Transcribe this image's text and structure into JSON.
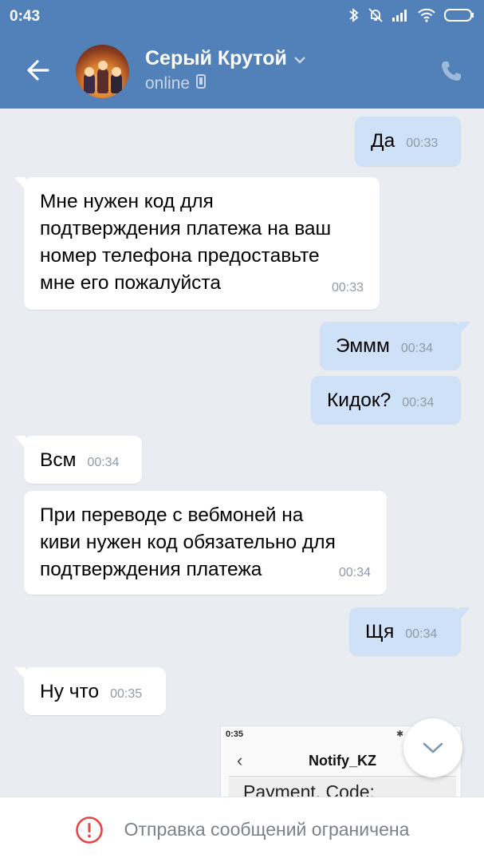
{
  "status_bar": {
    "time": "0:43",
    "icons": [
      "bluetooth-icon",
      "mute-bell-icon",
      "signal-icon",
      "wifi-icon",
      "battery-icon"
    ]
  },
  "header": {
    "contact_name": "Серый Крутой",
    "contact_status": "online",
    "icons": [
      "back-arrow-icon",
      "chevron-down-icon",
      "mobile-icon",
      "phone-icon"
    ]
  },
  "messages": [
    {
      "direction": "out",
      "text": "Да",
      "time": "00:33"
    },
    {
      "direction": "in",
      "text": "Мне нужен код для\nподтверждения платежа на ваш\nномер телефона предоставьте\nмне его пожалуйста",
      "time": "00:33"
    },
    {
      "direction": "out",
      "text": "Эммм",
      "time": "00:34"
    },
    {
      "direction": "out",
      "text": "Кидок?",
      "time": "00:34"
    },
    {
      "direction": "in",
      "text": "Всм",
      "time": "00:34"
    },
    {
      "direction": "in",
      "text": "При переводе с вебмоней на\nкиви нужен код обязательно для\nподтверждения платежа",
      "time": "00:34"
    },
    {
      "direction": "out",
      "text": "Щя",
      "time": "00:34"
    },
    {
      "direction": "in",
      "text": "Ну что",
      "time": "00:35"
    }
  ],
  "attachment": {
    "time": "0:35",
    "title": "Notify_KZ",
    "body": "Payment. Code:"
  },
  "bottom_bar": {
    "text": "Отправка сообщений ограничена",
    "icon": "alert-circle-icon",
    "accent": "#e64646"
  },
  "colors": {
    "header": "#5181b8",
    "background": "#e9edf2",
    "outgoing": "#cfe1f6",
    "incoming": "#ffffff"
  }
}
